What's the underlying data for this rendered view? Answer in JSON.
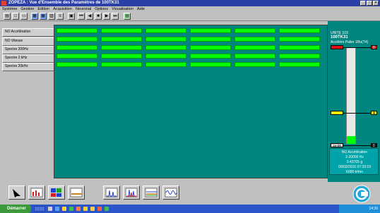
{
  "window": {
    "title": "ZOPEZA : Vue d'Ensemble des Paramètres de 100TK31",
    "min": "_",
    "max": "▫",
    "close": "×"
  },
  "menu": [
    "Système",
    "Gestion",
    "Edition",
    "Acquisition",
    "Neuronal",
    "Options",
    "Visualisation",
    "Aide"
  ],
  "toolbar": {
    "buttons": [
      {
        "icon": "print-icon",
        "glyph": "▤"
      },
      {
        "icon": "new-file-icon",
        "glyph": "□"
      },
      {
        "icon": "window-icon",
        "glyph": "▭"
      },
      {
        "icon": "display-icon",
        "glyph": "▦"
      },
      {
        "icon": "grid-icon",
        "glyph": "▦"
      },
      {
        "icon": "chart-icon",
        "glyph": "▥"
      },
      {
        "icon": "list-icon",
        "glyph": "≡"
      },
      {
        "icon": "save-icon",
        "glyph": "▣"
      },
      {
        "icon": "first-icon",
        "glyph": "⏮"
      },
      {
        "icon": "prev-icon",
        "glyph": "◀"
      },
      {
        "icon": "stop-icon",
        "glyph": "■"
      },
      {
        "icon": "next-icon",
        "glyph": "▶"
      },
      {
        "icon": "last-icon",
        "glyph": "⏭"
      },
      {
        "icon": "export-icon",
        "glyph": "▤"
      }
    ]
  },
  "sidebar": {
    "items": [
      {
        "label": "NO Accélération"
      },
      {
        "label": "NO Vitesse"
      },
      {
        "label": "Spectre 200Hz"
      },
      {
        "label": "Spectre 2 kHz"
      },
      {
        "label": "Spectre 20kHz"
      }
    ]
  },
  "right_panel": {
    "header1": "UNITE 103",
    "header2": "100TK31",
    "header3": "Accéléro Palier 1Ru(T4)",
    "top_marker": "D",
    "mid_marker": "A",
    "low_label": "1e-05",
    "bottom_marker": "D",
    "info_title": "NO Accélération",
    "info_range": "2-20000 Hz",
    "info_value": "0.43705 g",
    "info_date": "09/03/2016 07:33:19",
    "info_speed": "6000 tr/mn"
  },
  "colors": {
    "teal": "#00857f",
    "green": "#00ff00",
    "red": "#e01010",
    "yellow": "#f0f000"
  },
  "taskbar": {
    "start_label": "Démarrer",
    "clock": "14:36"
  }
}
